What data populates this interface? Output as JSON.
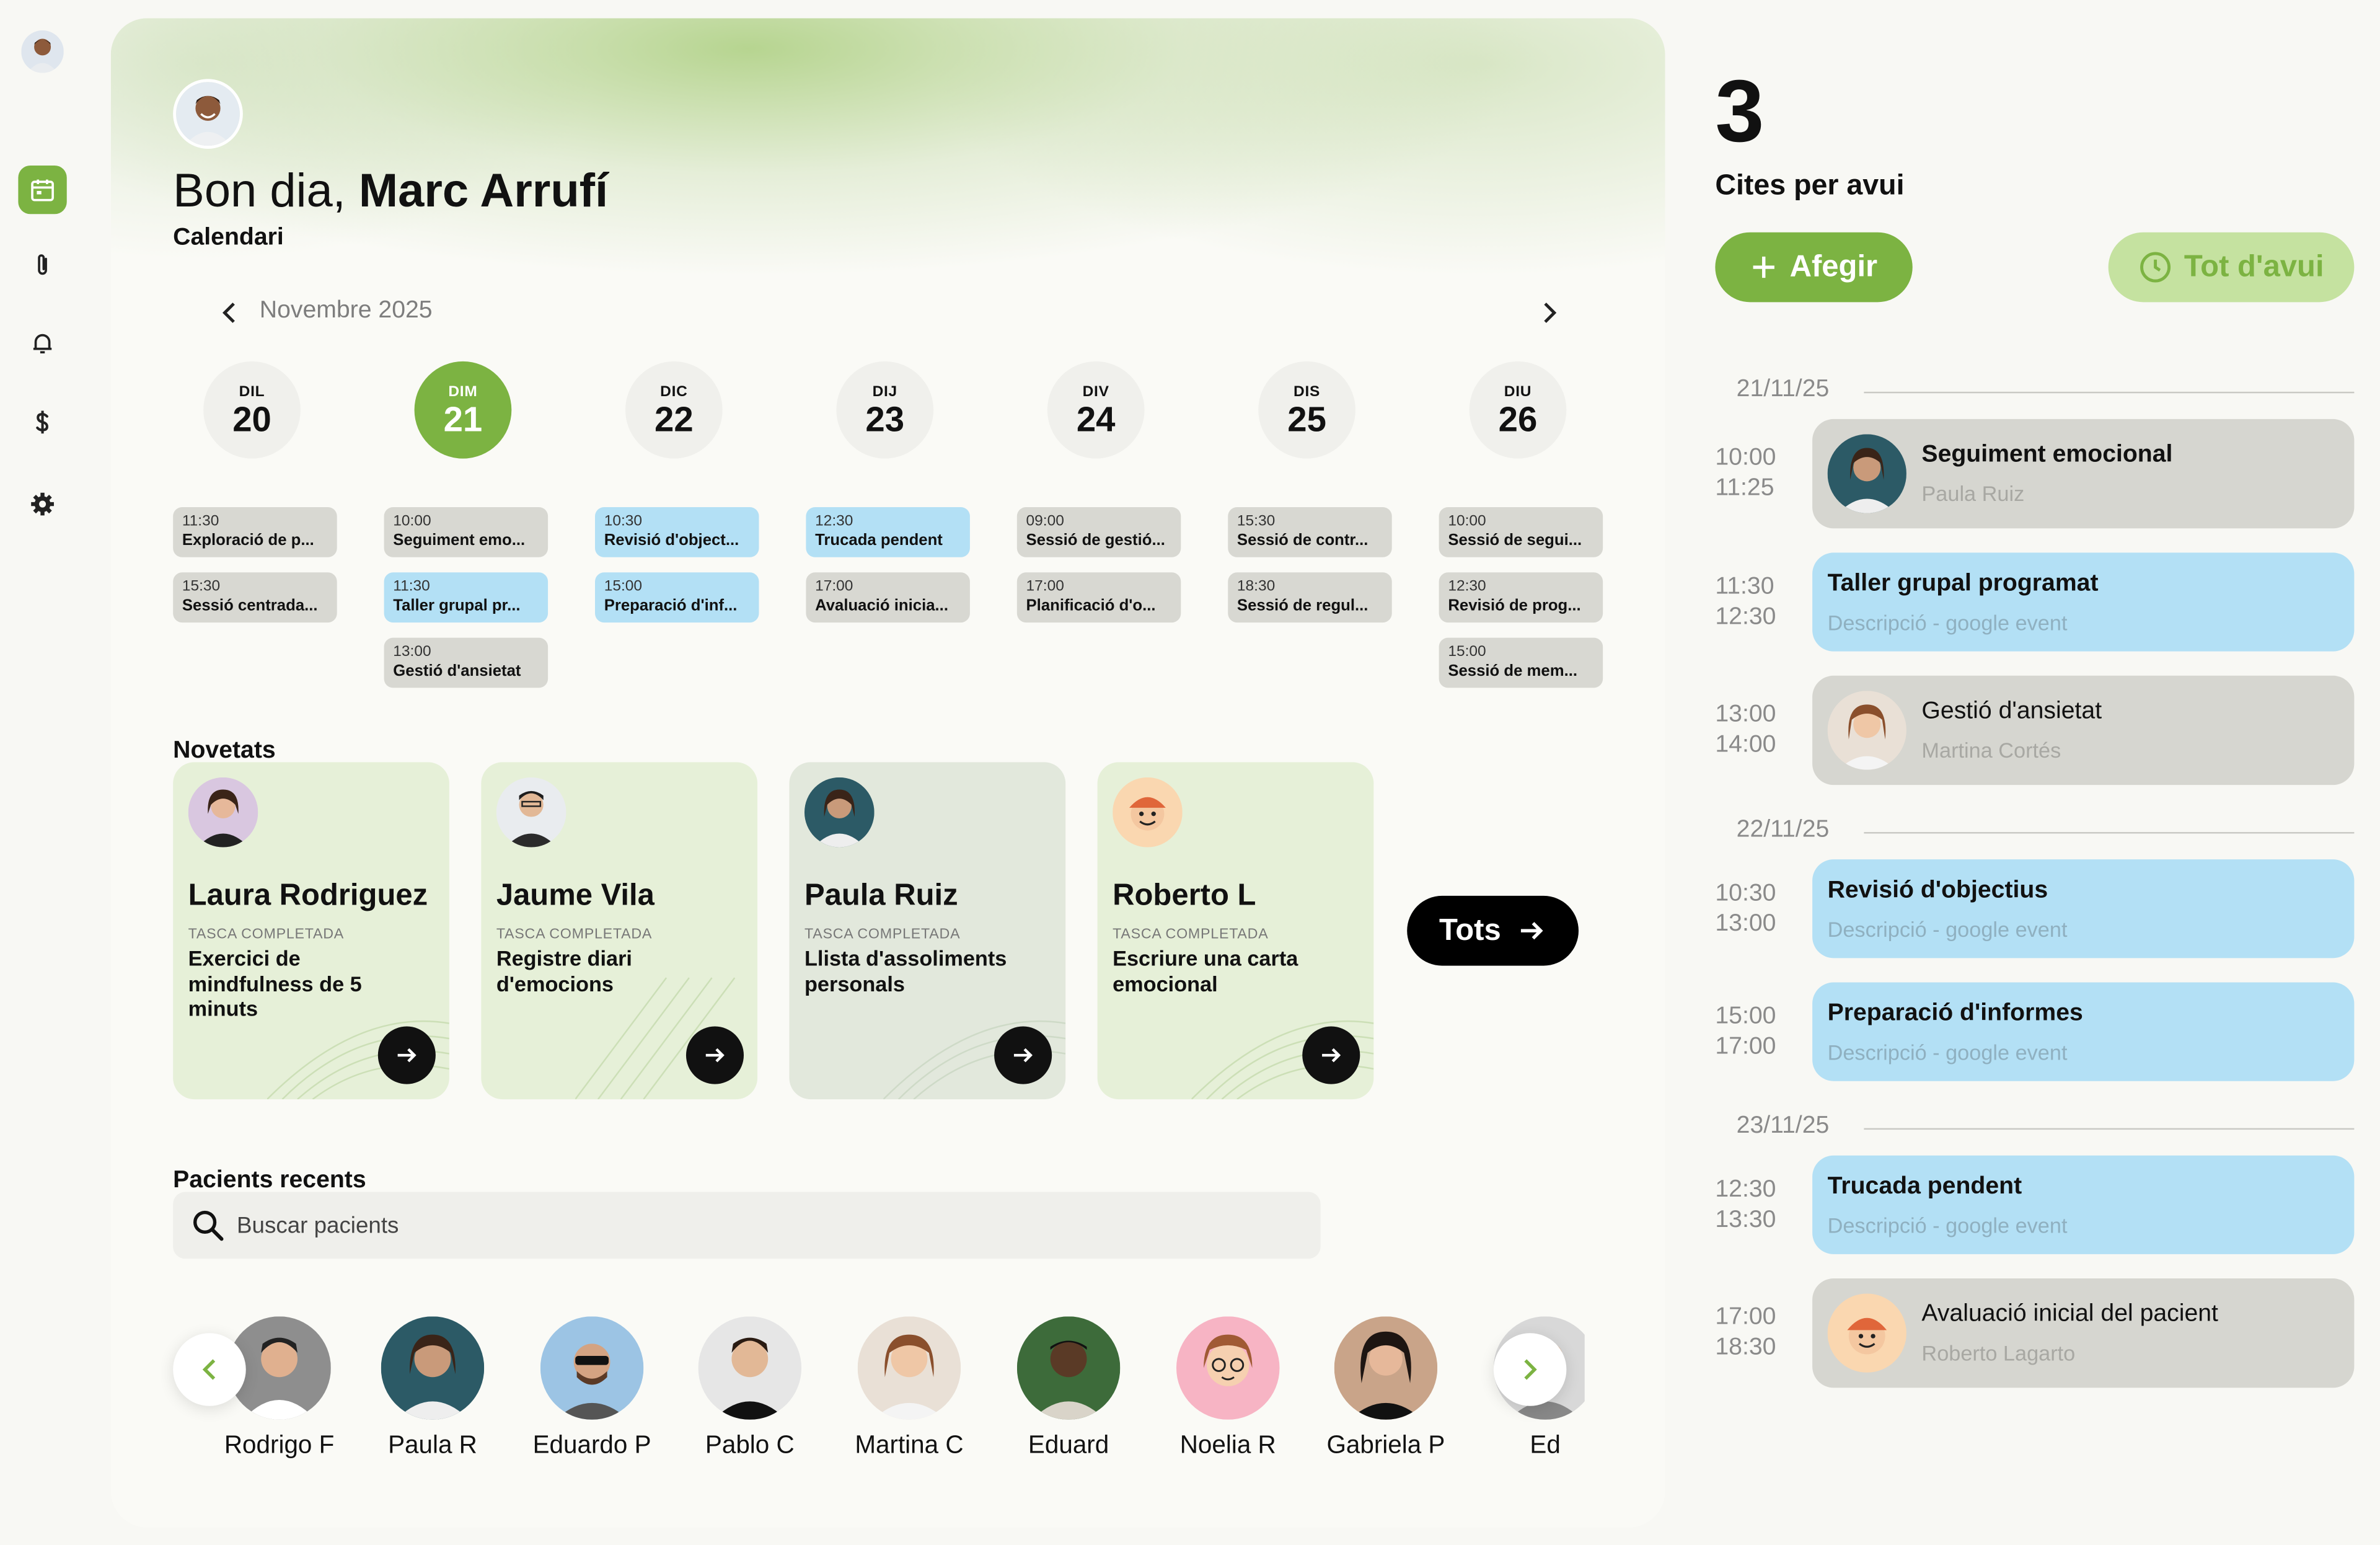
{
  "user": {
    "greeting": "Bon dia,",
    "name": "Marc Arrufí"
  },
  "calendar": {
    "label": "Calendari",
    "month": "Novembre 2025",
    "days": [
      {
        "name": "DIL",
        "num": "20",
        "events": [
          {
            "time": "11:30",
            "title": "Exploració de p...",
            "color": "gray"
          },
          {
            "time": "15:30",
            "title": "Sessió centrada...",
            "color": "gray"
          }
        ]
      },
      {
        "name": "DIM",
        "num": "21",
        "active": true,
        "events": [
          {
            "time": "10:00",
            "title": "Seguiment emo...",
            "color": "gray"
          },
          {
            "time": "11:30",
            "title": "Taller grupal pr...",
            "color": "blue"
          },
          {
            "time": "13:00",
            "title": "Gestió d'ansietat",
            "color": "gray"
          }
        ]
      },
      {
        "name": "DIC",
        "num": "22",
        "events": [
          {
            "time": "10:30",
            "title": "Revisió d'object...",
            "color": "blue"
          },
          {
            "time": "15:00",
            "title": "Preparació d'inf...",
            "color": "blue"
          }
        ]
      },
      {
        "name": "DIJ",
        "num": "23",
        "events": [
          {
            "time": "12:30",
            "title": "Trucada pendent",
            "color": "blue"
          },
          {
            "time": "17:00",
            "title": "Avaluació inicia...",
            "color": "gray"
          }
        ]
      },
      {
        "name": "DIV",
        "num": "24",
        "events": [
          {
            "time": "09:00",
            "title": "Sessió de gestió...",
            "color": "gray"
          },
          {
            "time": "17:00",
            "title": "Planificació d'o...",
            "color": "gray"
          }
        ]
      },
      {
        "name": "DIS",
        "num": "25",
        "events": [
          {
            "time": "15:30",
            "title": "Sessió de contr...",
            "color": "gray"
          },
          {
            "time": "18:30",
            "title": "Sessió de regul...",
            "color": "gray"
          }
        ]
      },
      {
        "name": "DIU",
        "num": "26",
        "events": [
          {
            "time": "10:00",
            "title": "Sessió de segui...",
            "color": "gray"
          },
          {
            "time": "12:30",
            "title": "Revisió de prog...",
            "color": "gray"
          },
          {
            "time": "15:00",
            "title": "Sessió de mem...",
            "color": "gray"
          }
        ]
      }
    ]
  },
  "news": {
    "title": "Novetats",
    "all_label": "Tots",
    "cards": [
      {
        "name": "Laura Rodriguez",
        "tag": "TASCA COMPLETADA",
        "task": "Exercici de mindfulness de 5 minuts"
      },
      {
        "name": "Jaume Vila",
        "tag": "TASCA COMPLETADA",
        "task": "Registre diari d'emocions"
      },
      {
        "name": "Paula Ruiz",
        "tag": "TASCA COMPLETADA",
        "task": "Llista d'assoliments personals"
      },
      {
        "name": "Roberto L",
        "tag": "TASCA COMPLETADA",
        "task": "Escriure una carta emocional"
      }
    ]
  },
  "patients": {
    "title": "Pacients recents",
    "search_placeholder": "Buscar pacients",
    "list": [
      "Rodrigo F",
      "Paula R",
      "Eduardo P",
      "Pablo C",
      "Martina C",
      "Eduard",
      "Noelia R",
      "Gabriela P",
      "Ed"
    ]
  },
  "today": {
    "count": "3",
    "label": "Cites per avui",
    "add_label": "Afegir",
    "all_today_label": "Tot d'avui",
    "groups": [
      {
        "date": "21/11/25",
        "items": [
          {
            "start": "10:00",
            "end": "11:25",
            "title": "Seguiment emocional",
            "sub": "Paula Ruiz",
            "color": "gray"
          },
          {
            "start": "11:30",
            "end": "12:30",
            "title": "Taller grupal programat",
            "sub": "Descripció - google event",
            "color": "blue"
          },
          {
            "start": "13:00",
            "end": "14:00",
            "title": "Gestió d'ansietat",
            "sub": "Martina Cortés",
            "color": "gray"
          }
        ]
      },
      {
        "date": "22/11/25",
        "items": [
          {
            "start": "10:30",
            "end": "13:00",
            "title": "Revisió d'objectius",
            "sub": "Descripció - google event",
            "color": "blue"
          },
          {
            "start": "15:00",
            "end": "17:00",
            "title": "Preparació d'informes",
            "sub": "Descripció - google event",
            "color": "blue"
          }
        ]
      },
      {
        "date": "23/11/25",
        "items": [
          {
            "start": "12:30",
            "end": "13:30",
            "title": "Trucada pendent",
            "sub": "Descripció - google event",
            "color": "blue"
          },
          {
            "start": "17:00",
            "end": "18:30",
            "title": "Avaluació inicial del pacient",
            "sub": "Roberto Lagarto",
            "color": "gray"
          }
        ]
      }
    ]
  },
  "colors": {
    "accent": "#7cb342",
    "accent_light": "#c5e2a0",
    "event_blue": "#b3e0f5",
    "event_gray": "#d6d6d0"
  }
}
